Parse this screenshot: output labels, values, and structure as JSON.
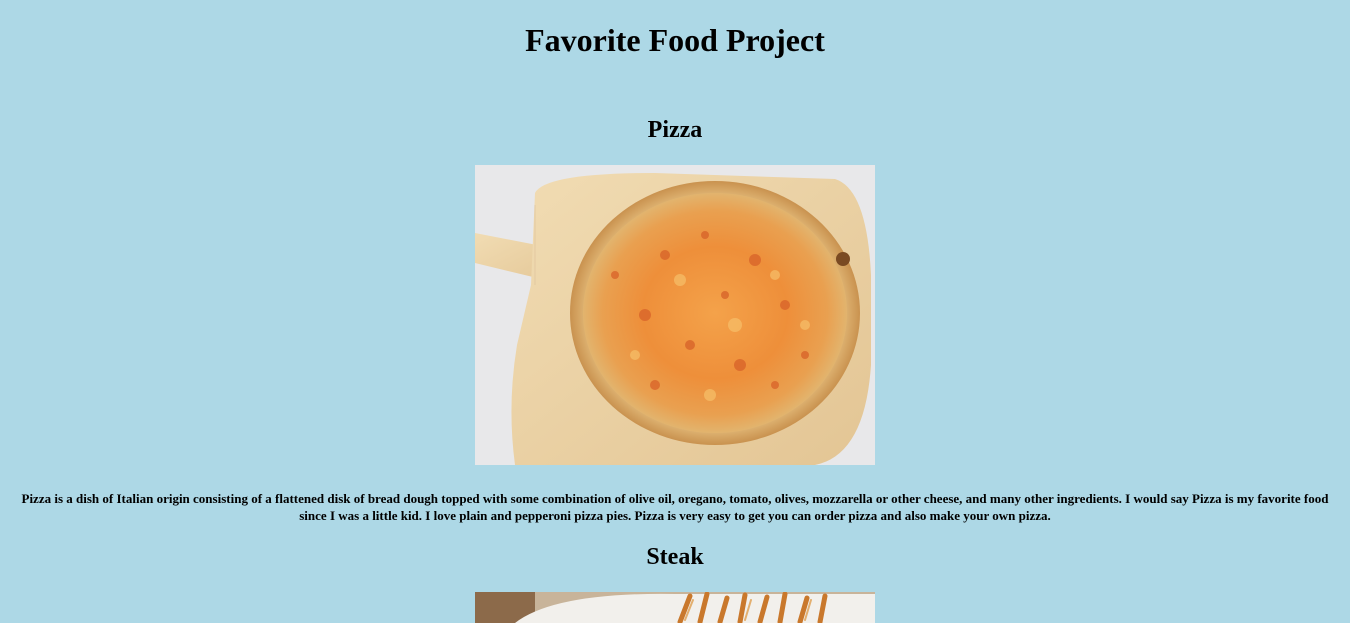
{
  "page": {
    "title": "Favorite Food Project"
  },
  "foods": [
    {
      "name": "Pizza",
      "image_subject": "pizza-on-wooden-peel",
      "description": "Pizza is a dish of Italian origin consisting of a flattened disk of bread dough topped with some combination of olive oil, oregano, tomato, olives, mozzarella or other cheese, and many other ingredients. I would say Pizza is my favorite food since I was a little kid. I love plain and pepperoni pizza pies. Pizza is very easy to get you can order pizza and also make your own pizza."
    },
    {
      "name": "Steak",
      "image_subject": "steak-with-fries"
    }
  ],
  "colors": {
    "background": "#add8e6",
    "text": "#000000"
  }
}
